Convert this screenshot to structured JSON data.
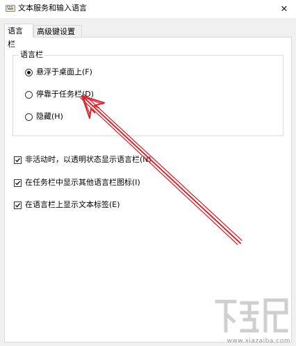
{
  "window": {
    "title": "文本服务和输入语言",
    "close_glyph": "✕",
    "app_icon": "keyboard-icon"
  },
  "tabs": [
    {
      "label": "语言栏",
      "active": true
    },
    {
      "label": "高级键设置",
      "active": false
    }
  ],
  "language_bar_group": {
    "legend": "语言栏",
    "options": [
      {
        "label": "悬浮于桌面上(F)",
        "checked": true
      },
      {
        "label": "停靠于任务栏(D)",
        "checked": false
      },
      {
        "label": "隐藏(H)",
        "checked": false
      }
    ]
  },
  "checkboxes": [
    {
      "label": "非活动时，以透明状态显示语言栏(N)",
      "checked": true
    },
    {
      "label": "在任务栏中显示其他语言栏图标(I)",
      "checked": true
    },
    {
      "label": "在语言栏上显示文本标签(E)",
      "checked": true
    }
  ],
  "annotation": {
    "arrow_color": "#d9262c"
  },
  "watermark": {
    "logo_text": "下载吧",
    "url": "www.xiazaiba.com"
  }
}
